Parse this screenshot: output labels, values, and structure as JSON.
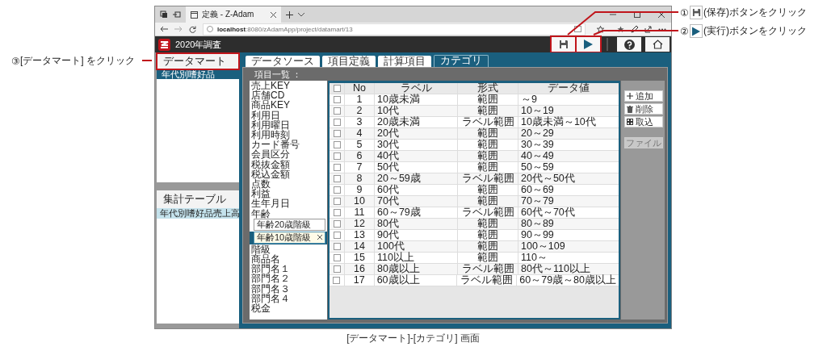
{
  "callouts": [
    {
      "number": "①",
      "kind": "save",
      "text": "(保存)ボタンをクリック"
    },
    {
      "number": "②",
      "kind": "run",
      "text": "(実行)ボタンをクリック"
    },
    {
      "number": "③",
      "kind": "plain",
      "text": "[データマート] をクリック"
    }
  ],
  "browser": {
    "tab_title": "定義 - Z-Adam",
    "url": "**localhost**:8080/zAdamApp/project/datamart/13"
  },
  "app": {
    "title": "2020年調査",
    "buttons": [
      {
        "kind": "save",
        "highlighted": true
      },
      {
        "kind": "run",
        "highlighted": true
      },
      {
        "kind": "help",
        "highlighted": false
      },
      {
        "kind": "home",
        "highlighted": false
      }
    ]
  },
  "sidebar": {
    "header": {
      "label": "データマート",
      "highlighted": true
    },
    "items": [
      {
        "label": "年代別嗜好品",
        "selected": true
      }
    ],
    "section_header": "集計テーブル",
    "section_items": [
      {
        "label": "年代別嗜好品売上高",
        "selected": true
      }
    ]
  },
  "tabs": [
    {
      "label": "データソース",
      "selected": false
    },
    {
      "label": "項目定義",
      "selected": false
    },
    {
      "label": "計算項目",
      "selected": false
    },
    {
      "label": "カテゴリ",
      "selected": true
    }
  ],
  "item_list": {
    "title": "項目一覧 ：",
    "items": [
      {
        "label": "売上KEY"
      },
      {
        "label": "店舗CD"
      },
      {
        "label": "商品KEY"
      },
      {
        "label": "利用日"
      },
      {
        "label": "利用曜日"
      },
      {
        "label": "利用時刻"
      },
      {
        "label": "カード番号"
      },
      {
        "label": "会員区分"
      },
      {
        "label": "税抜金額"
      },
      {
        "label": "税込金額"
      },
      {
        "label": "点数"
      },
      {
        "label": "利益"
      },
      {
        "label": "生年月日"
      },
      {
        "label": "年齢",
        "children": [
          {
            "label": "年齢20歳階級",
            "selected": false
          },
          {
            "label": "年齢10歳階級",
            "selected": true
          }
        ]
      },
      {
        "label": "階級"
      },
      {
        "label": "商品名"
      },
      {
        "label": "部門名１"
      },
      {
        "label": "部門名２"
      },
      {
        "label": "部門名３"
      },
      {
        "label": "部門名４"
      },
      {
        "label": "税金"
      }
    ]
  },
  "table": {
    "all_checked": false,
    "columns": [
      "No",
      "ラベル",
      "形式",
      "データ値"
    ],
    "rows": [
      {
        "checked": false,
        "no": "1",
        "label": "10歳未満",
        "format": "範囲",
        "value": "～9"
      },
      {
        "checked": false,
        "no": "2",
        "label": "10代",
        "format": "範囲",
        "value": "10～19"
      },
      {
        "checked": false,
        "no": "3",
        "label": "20歳未満",
        "format": "ラベル範囲",
        "value": "10歳未満～10代"
      },
      {
        "checked": false,
        "no": "4",
        "label": "20代",
        "format": "範囲",
        "value": "20～29"
      },
      {
        "checked": false,
        "no": "5",
        "label": "30代",
        "format": "範囲",
        "value": "30～39"
      },
      {
        "checked": false,
        "no": "6",
        "label": "40代",
        "format": "範囲",
        "value": "40～49"
      },
      {
        "checked": false,
        "no": "7",
        "label": "50代",
        "format": "範囲",
        "value": "50～59"
      },
      {
        "checked": false,
        "no": "8",
        "label": "20～59歳",
        "format": "ラベル範囲",
        "value": "20代～50代"
      },
      {
        "checked": false,
        "no": "9",
        "label": "60代",
        "format": "範囲",
        "value": "60～69"
      },
      {
        "checked": false,
        "no": "10",
        "label": "70代",
        "format": "範囲",
        "value": "70～79"
      },
      {
        "checked": false,
        "no": "11",
        "label": "60～79歳",
        "format": "ラベル範囲",
        "value": "60代～70代"
      },
      {
        "checked": false,
        "no": "12",
        "label": "80代",
        "format": "範囲",
        "value": "80～89"
      },
      {
        "checked": false,
        "no": "13",
        "label": "90代",
        "format": "範囲",
        "value": "90～99"
      },
      {
        "checked": false,
        "no": "14",
        "label": "100代",
        "format": "範囲",
        "value": "100～109"
      },
      {
        "checked": false,
        "no": "15",
        "label": "110以上",
        "format": "範囲",
        "value": "110～"
      },
      {
        "checked": false,
        "no": "16",
        "label": "80歳以上",
        "format": "ラベル範囲",
        "value": "80代～110以上"
      },
      {
        "checked": false,
        "no": "17",
        "label": "60歳以上",
        "format": "ラベル範囲",
        "value": "60～79歳～80歳以上"
      }
    ]
  },
  "actions": [
    {
      "kind": "add",
      "label": "追加",
      "disabled": false
    },
    {
      "kind": "delete",
      "label": "削除",
      "disabled": false
    },
    {
      "kind": "import",
      "label": "取込",
      "disabled": false
    },
    {
      "kind": "file",
      "label": "ファイル",
      "disabled": true
    }
  ],
  "caption": "[データマート]-[カテゴリ] 画面"
}
